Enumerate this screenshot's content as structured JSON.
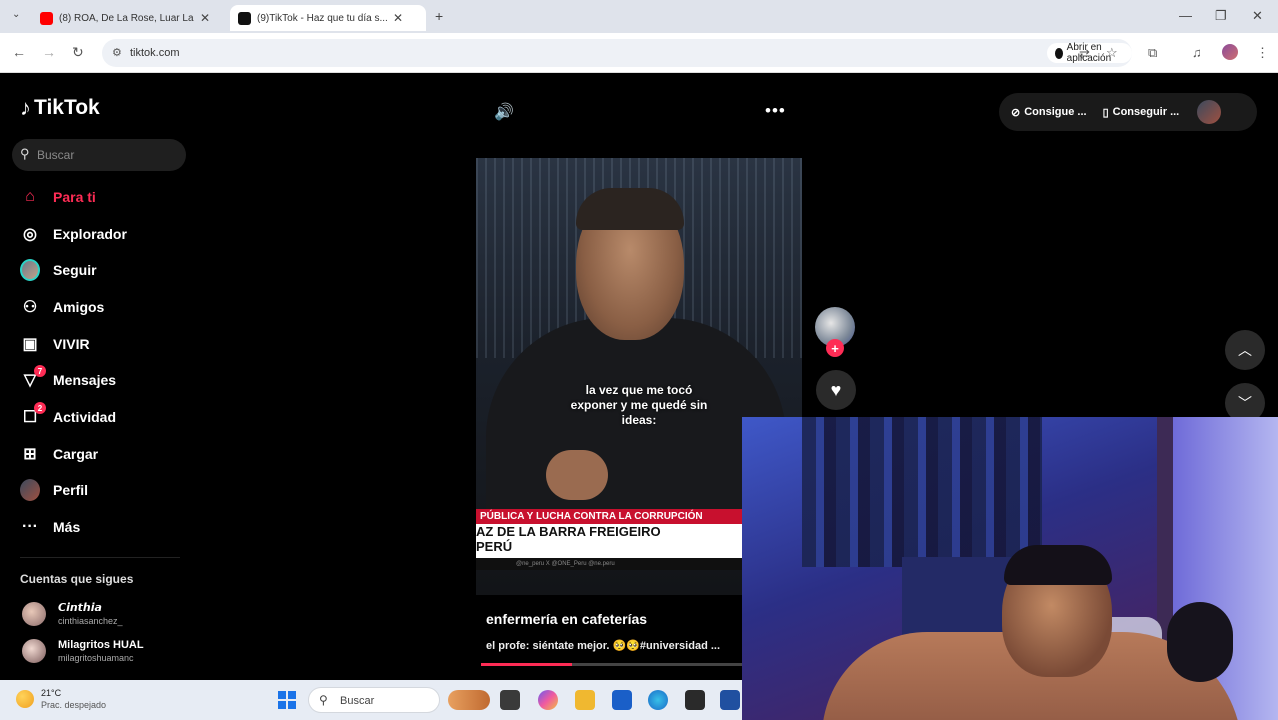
{
  "browser": {
    "tabs": [
      {
        "title": "(8) ROA, De La Rose, Luar La L...",
        "active": false
      },
      {
        "title": "(9)TikTok - Haz que tu día s...",
        "active": true
      }
    ],
    "new_tab_symbol": "+",
    "url": "tiktok.com",
    "open_app_label": "Abrir en aplicación"
  },
  "tiktok": {
    "logo_text": "TikTok",
    "search_placeholder": "Buscar",
    "nav": [
      {
        "label": "Para ti",
        "icon": "home-icon",
        "active": true
      },
      {
        "label": "Explorador",
        "icon": "compass-icon"
      },
      {
        "label": "Seguir",
        "icon": "following-avatar-icon"
      },
      {
        "label": "Amigos",
        "icon": "friends-icon"
      },
      {
        "label": "VIVIR",
        "icon": "live-tv-icon"
      },
      {
        "label": "Mensajes",
        "icon": "messages-icon",
        "badge": "7"
      },
      {
        "label": "Actividad",
        "icon": "activity-icon",
        "badge": "2"
      },
      {
        "label": "Cargar",
        "icon": "upload-icon"
      },
      {
        "label": "Perfil",
        "icon": "profile-avatar-icon"
      },
      {
        "label": "Más",
        "icon": "more-icon"
      }
    ],
    "following_heading": "Cuentas que sigues",
    "following": [
      {
        "name": "𝘾𝙞𝙣𝙩𝙝𝙞𝙖",
        "handle": "cinthiasanchez_"
      },
      {
        "name": "Milagritos HUAL",
        "handle": "milagritoshuamanc"
      }
    ],
    "top_right": {
      "coins_label": "Consigue ...",
      "app_label": "Conseguir ..."
    },
    "video": {
      "caption": "la vez que me tocó exponer y me quedé sin ideas:",
      "lower_third_red": "PÚBLICA Y LUCHA CONTRA LA CORRUPCIÓN",
      "lower_third_line1": "AZ DE LA BARRA FREIGEIRO",
      "lower_third_line2": "PERÚ",
      "lower_third_small": "@ne_peru    X @ONE_Peru    @ne.peru",
      "title": "enfermería en cafeterías",
      "description": "el profe: siéntate mejor. 🥺🥺#universidad ...",
      "progress": 0.35
    }
  },
  "taskbar": {
    "temperature": "21°C",
    "weather": "Prac. despejado",
    "search_label": "Buscar"
  },
  "colors": {
    "accent": "#fe2c55",
    "background": "#000000"
  }
}
